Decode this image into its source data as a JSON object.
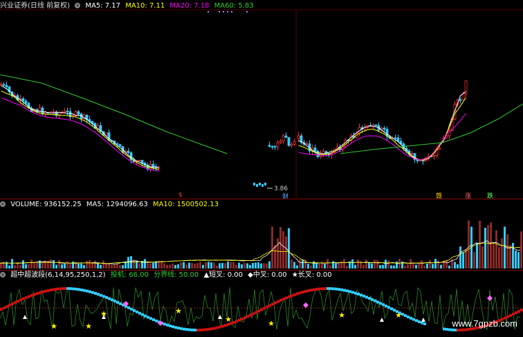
{
  "main_panel": {
    "title": "兴业证券(日线 前复权)",
    "indicators": [
      {
        "label": "MA5: 7.17",
        "color": "#ffffff"
      },
      {
        "label": "MA10: 7.11",
        "color": "#ffff00"
      },
      {
        "label": "MA20: 7.18",
        "color": "#ff00ff"
      },
      {
        "label": "MA60: 5.83",
        "color": "#00cc00"
      }
    ],
    "low_price_label": "3.86",
    "markers": [
      {
        "text": "$",
        "color": "#ff3333"
      },
      {
        "text": "财",
        "color": "#66aaff"
      },
      {
        "text": "赣",
        "color": "#ffcc00"
      },
      {
        "text": "涨",
        "color": "#ff6666"
      },
      {
        "text": "跌",
        "color": "#66ff66"
      }
    ]
  },
  "volume_panel": {
    "indicators": [
      {
        "label": "VOLUME: 936152.25",
        "color": "#ffffff"
      },
      {
        "label": "MA5: 1294096.63",
        "color": "#ffffff"
      },
      {
        "label": "MA10: 1500502.13",
        "color": "#ffff00"
      }
    ]
  },
  "wave_panel": {
    "title": "超中超波段(6,14,95,250,1,2)",
    "indicators": [
      {
        "label": "投机: 66.00",
        "color": "#33cc33"
      },
      {
        "label": "分界线: 50.00",
        "color": "#33cc33"
      },
      {
        "label": "▲短叉: 0.00",
        "color": "#ffffff"
      },
      {
        "label": "◆中叉: 0.00",
        "color": "#ffffff"
      },
      {
        "label": "★长叉: 0.00",
        "color": "#ffffff"
      }
    ]
  },
  "watermark": "www.7gpzb.com",
  "colors": {
    "up": "#ff3333",
    "down": "#33ccff",
    "ma5": "#ffffff",
    "ma10": "#ffff00",
    "ma20": "#ff00ff",
    "ma60": "#33cc33"
  }
}
